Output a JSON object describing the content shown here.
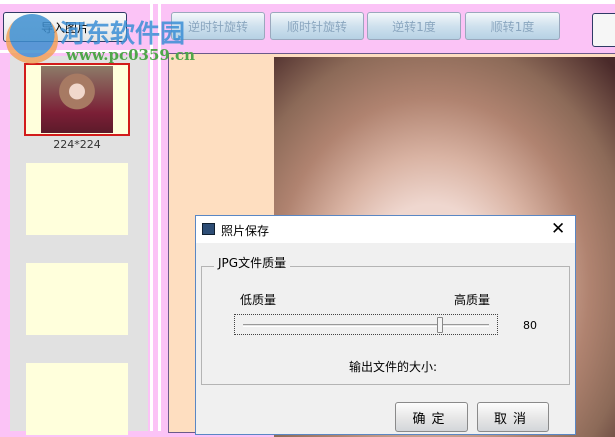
{
  "toolbar": {
    "import_label": "导入图片",
    "buttons": [
      "逆时针旋转",
      "顺时针旋转",
      "逆转1度",
      "顺转1度"
    ]
  },
  "thumbnails": {
    "first_size": "224*224"
  },
  "watermark": {
    "name": "河东软件园",
    "url": "www.pc0359.cn"
  },
  "dialog": {
    "title": "照片保存",
    "group_label": "JPG文件质量",
    "low_label": "低质量",
    "high_label": "高质量",
    "quality_value": "80",
    "quality_fraction": 0.8,
    "output_size_label": "输出文件的大小:",
    "ok_label": "确定",
    "cancel_label": "取消"
  }
}
